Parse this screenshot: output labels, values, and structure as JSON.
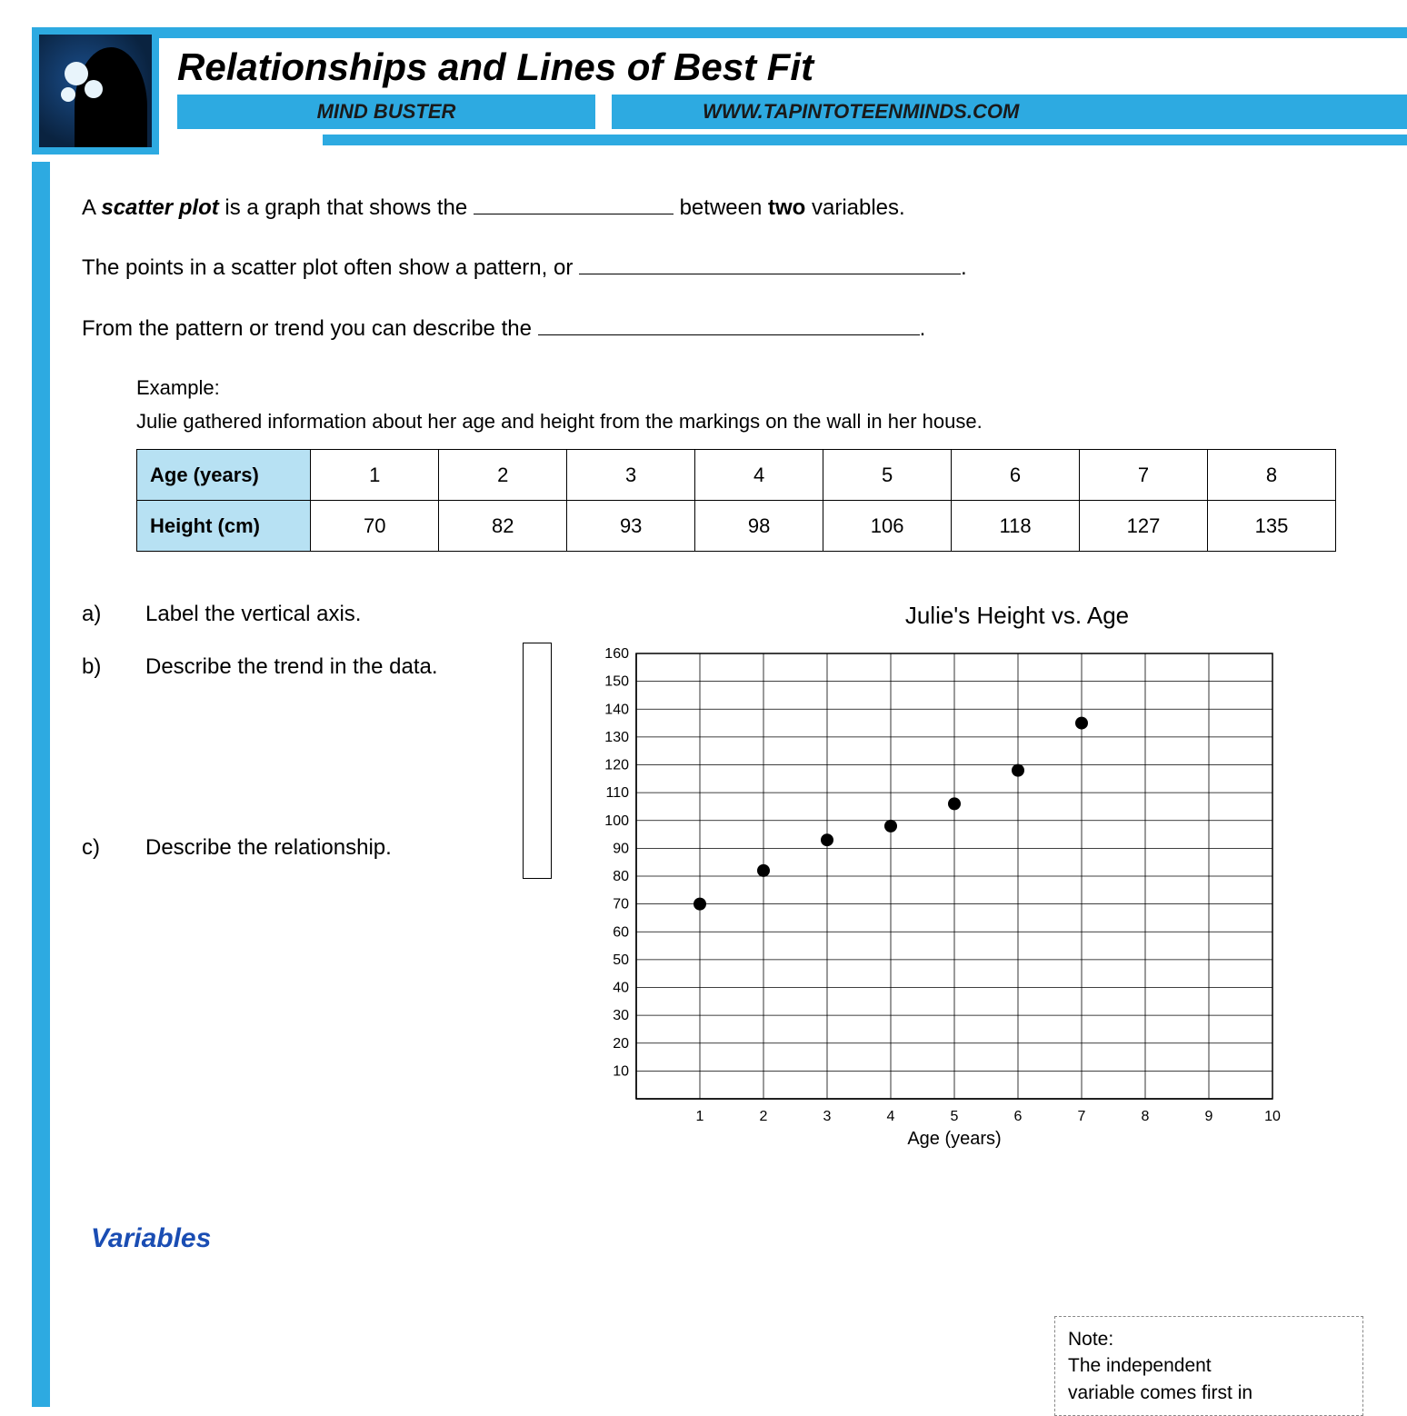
{
  "header": {
    "title": "Relationships and Lines of Best Fit",
    "sub_left": "MIND BUSTER",
    "sub_right": "WWW.TAPINTOTEENMINDS.COM"
  },
  "intro": {
    "line1_a": "A ",
    "line1_bold": "scatter plot",
    "line1_b": " is a graph that shows the ",
    "line1_c": " between ",
    "line1_two": "two",
    "line1_d": " variables.",
    "line2_a": "The points in a scatter plot often show a pattern, or ",
    "line2_end": ".",
    "line3_a": "From the pattern or trend you can describe the ",
    "line3_end": "."
  },
  "example": {
    "label": "Example:",
    "desc": "Julie gathered information about her age and height from the markings on the wall in her house.",
    "row1_header": "Age (years)",
    "row2_header": "Height (cm)",
    "ages": [
      "1",
      "2",
      "3",
      "4",
      "5",
      "6",
      "7",
      "8"
    ],
    "heights": [
      "70",
      "82",
      "93",
      "98",
      "106",
      "118",
      "127",
      "135"
    ]
  },
  "questions": {
    "a_letter": "a)",
    "a_text": "Label the vertical axis.",
    "b_letter": "b)",
    "b_text": "Describe the trend in the data.",
    "c_letter": "c)",
    "c_text": "Describe the relationship."
  },
  "chart_data": {
    "type": "scatter",
    "title": "Julie's Height vs. Age",
    "xlabel": "Age (years)",
    "ylabel": "",
    "xlim": [
      0,
      10
    ],
    "ylim": [
      0,
      160
    ],
    "x_ticks": [
      1,
      2,
      3,
      4,
      5,
      6,
      7,
      8,
      9,
      10
    ],
    "y_ticks": [
      10,
      20,
      30,
      40,
      50,
      60,
      70,
      80,
      90,
      100,
      110,
      120,
      130,
      140,
      150,
      160
    ],
    "series": [
      {
        "name": "Height",
        "x": [
          1,
          2,
          3,
          4,
          5,
          6,
          7
        ],
        "y": [
          70,
          82,
          93,
          98,
          106,
          118,
          135
        ]
      }
    ]
  },
  "sections": {
    "variables_heading": "Variables"
  },
  "note": {
    "label": "Note:",
    "line1": "The independent",
    "line2": "variable comes first in"
  }
}
